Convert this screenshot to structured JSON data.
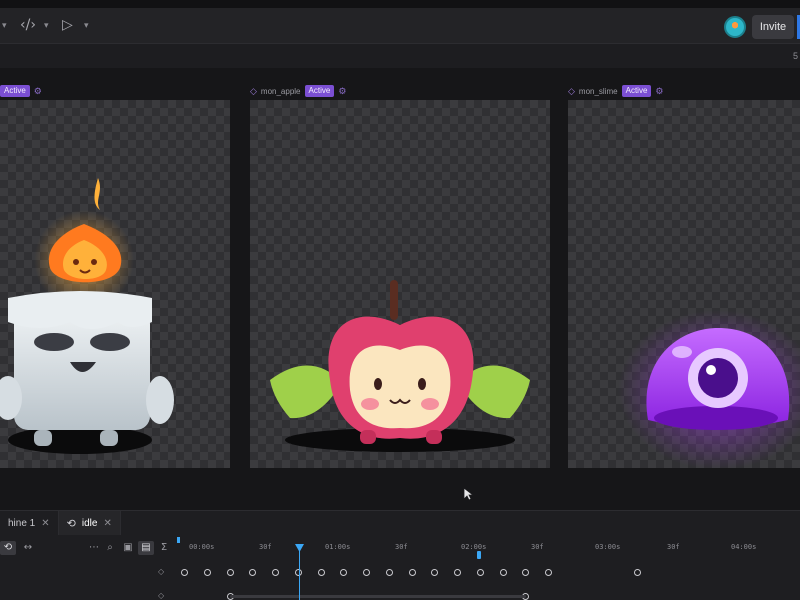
{
  "toolbar": {
    "invite_label": "Invite"
  },
  "subbar": {
    "zoom_text": "5"
  },
  "artboards": [
    {
      "name": "",
      "status": "Active"
    },
    {
      "name": "mon_apple",
      "status": "Active"
    },
    {
      "name": "mon_slime",
      "status": "Active"
    }
  ],
  "timeline": {
    "tabs": [
      {
        "label": "hine 1"
      },
      {
        "label": "idle"
      }
    ],
    "ruler_labels": [
      "00:00s",
      "30f",
      "01:00s",
      "30f",
      "02:00s",
      "30f",
      "03:00s",
      "30f",
      "04:00s"
    ]
  },
  "colors": {
    "accent_purple": "#7b4fd3",
    "playhead_blue": "#3ba7f5",
    "invite_blue": "#2e78e6"
  },
  "icons": [
    "code-icon",
    "play-icon",
    "loop-icon",
    "close-icon",
    "gear-icon",
    "diamond-icon",
    "cursor-icon"
  ]
}
